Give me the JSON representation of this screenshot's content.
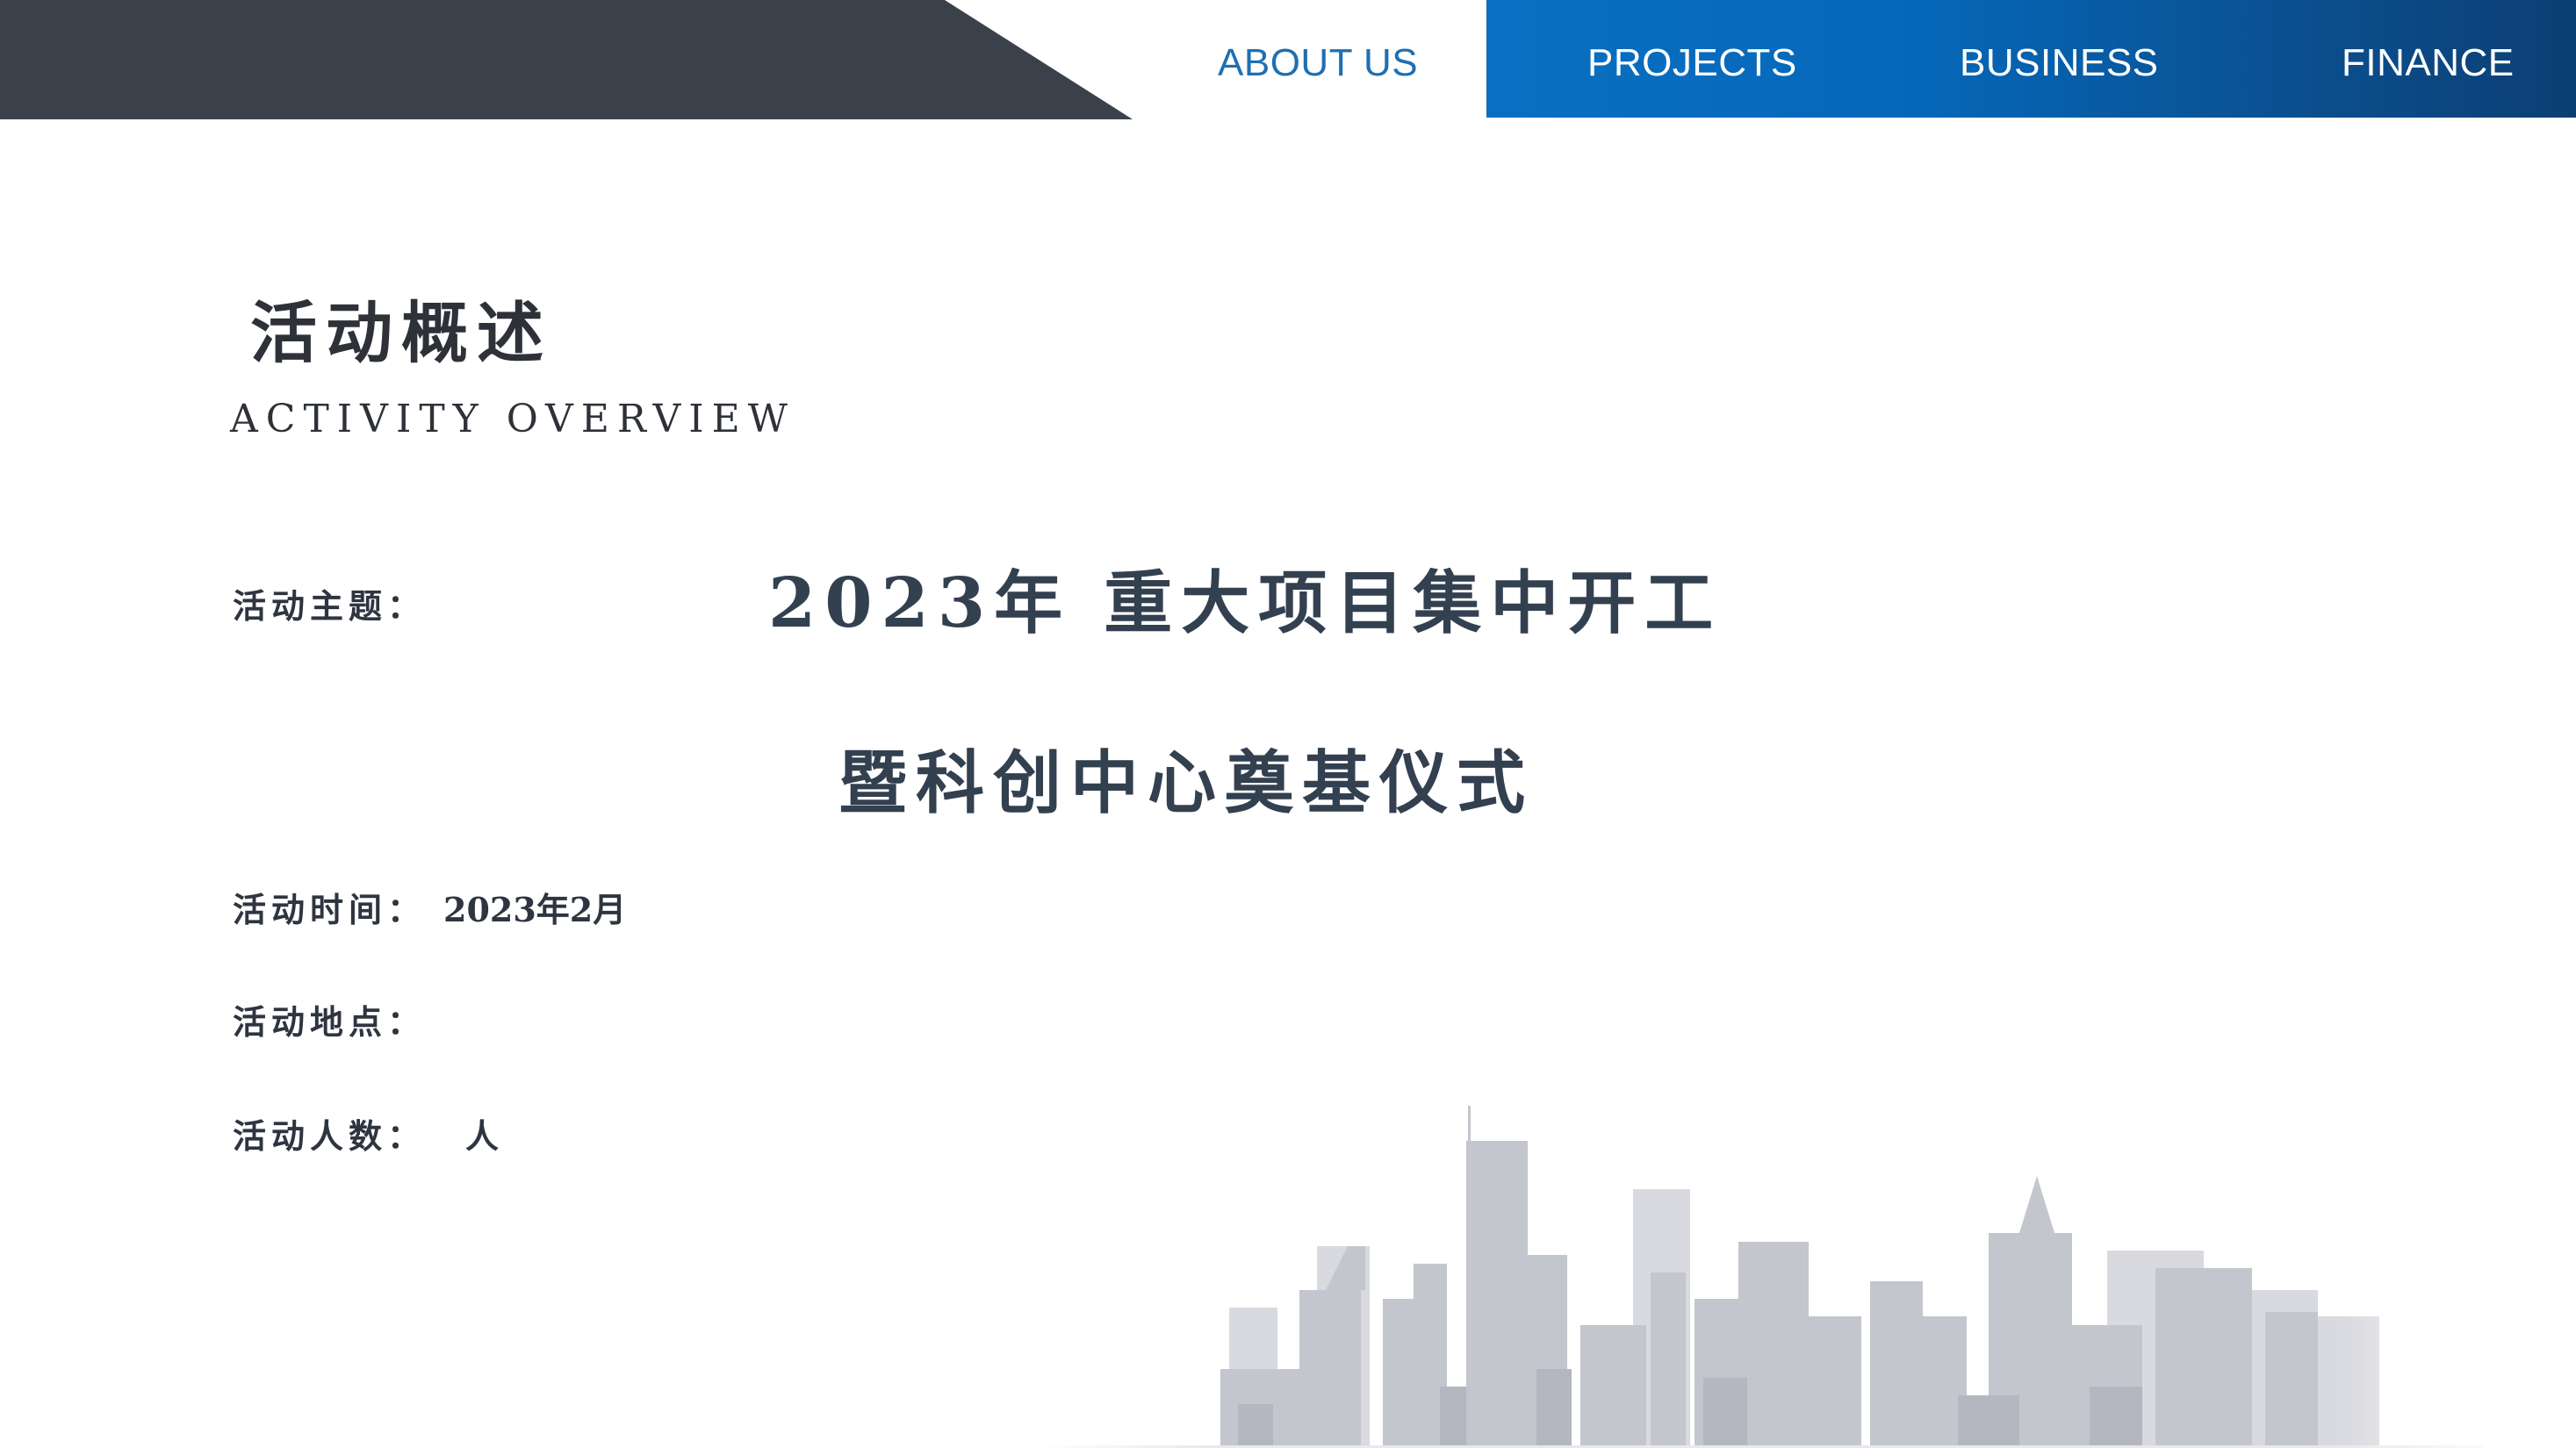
{
  "nav": {
    "items": [
      {
        "label": "ABOUT US",
        "active": true
      },
      {
        "label": "PROJECTS",
        "active": false
      },
      {
        "label": "BUSINESS",
        "active": false
      },
      {
        "label": "FINANCE",
        "active": false
      }
    ]
  },
  "section": {
    "title_cn": "活动概述",
    "title_en": "ACTIVITY  OVERVIEW"
  },
  "details": {
    "theme_label": "活动主题：",
    "theme_line1": "2023年 重大项目集中开工",
    "theme_line2": "暨科创中心奠基仪式",
    "time_label": "活动时间：",
    "time_value": "2023年2月",
    "place_label": "活动地点：",
    "people_label": "活动人数：",
    "people_value": "人"
  },
  "colors": {
    "dark_bar": "#3b414b",
    "nav_blue_start": "#0a6fc2",
    "nav_blue_end": "#0b3f73",
    "active_nav_text": "#1f6fb2",
    "skyline_gray": "#c5c7ce"
  }
}
